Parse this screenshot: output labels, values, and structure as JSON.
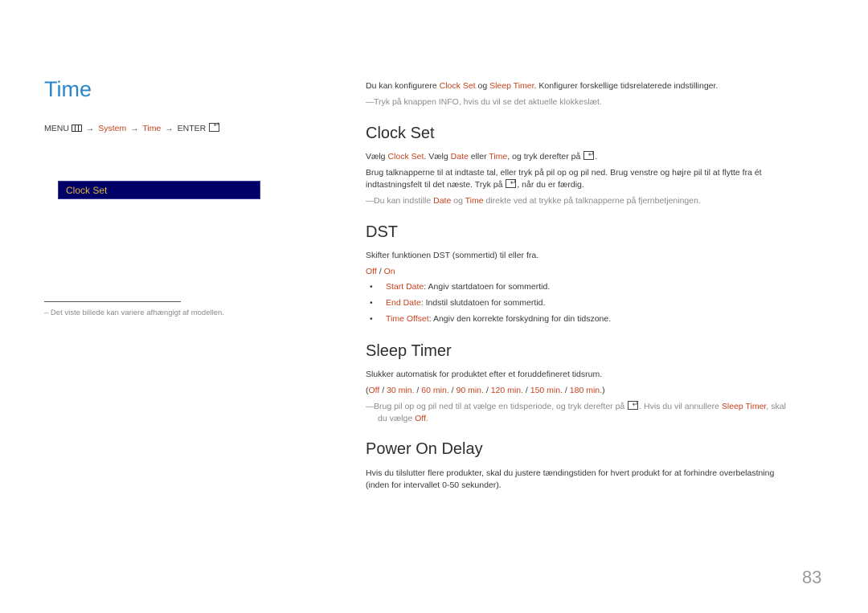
{
  "left": {
    "title": "Time",
    "menu_path": {
      "menu": "MENU",
      "menu_icon": "menu-grid-icon",
      "arrow": "→",
      "system": "System",
      "time": "Time",
      "enter": "ENTER",
      "enter_icon": "enter-icon"
    },
    "osd_item": "Clock Set",
    "footnote": "–  Det viste billede kan variere afhængigt af modellen."
  },
  "intro": {
    "t1": "Du kan konfigurere ",
    "h1": "Clock Set",
    "t2": " og ",
    "h2": "Sleep Timer",
    "t3": ". Konfigurer forskellige tidsrelaterede indstillinger.",
    "note_dash": "―",
    "note": "Tryk på knappen INFO, hvis du vil se det aktuelle klokkeslæt."
  },
  "clock_set": {
    "heading": "Clock Set",
    "l1_t1": "Vælg ",
    "l1_h1": "Clock Set",
    "l1_t2": ". Vælg ",
    "l1_h2": "Date",
    "l1_t3": " eller ",
    "l1_h3": "Time",
    "l1_t4": ", og tryk derefter på ",
    "l1_t5": ".",
    "l2": "Brug talknapperne til at indtaste tal, eller tryk på pil op og pil ned. Brug venstre og højre pil til at flytte fra ét",
    "l3_t1": "indtastningsfelt til det næste. Tryk på ",
    "l3_t2": ", når du er færdig.",
    "note_t1": "Du kan indstille ",
    "note_h1": "Date",
    "note_t2": " og ",
    "note_h2": "Time",
    "note_t3": " direkte ved at trykke på talknapperne på fjernbetjeningen."
  },
  "dst": {
    "heading": "DST",
    "desc": "Skifter funktionen DST (sommertid) til eller fra.",
    "opt_off": "Off",
    "opt_sep": " / ",
    "opt_on": "On",
    "bullets": [
      {
        "label": "Start Date",
        "text": ": Angiv startdatoen for sommertid."
      },
      {
        "label": "End Date",
        "text": ": Indstil slutdatoen for sommertid."
      },
      {
        "label": "Time Offset",
        "text": ": Angiv den korrekte forskydning for din tidszone."
      }
    ],
    "bullet_char": "•"
  },
  "sleep_timer": {
    "heading": "Sleep Timer",
    "desc": "Slukker automatisk for produktet efter et foruddefineret tidsrum.",
    "options": [
      "Off",
      "30 min.",
      "60 min.",
      "90 min.",
      "120 min.",
      "150 min.",
      "180 min."
    ],
    "open_paren": "(",
    "close_paren": ")",
    "sep": " / ",
    "note_t1": "Brug pil op og pil ned til at vælge en tidsperiode, og tryk derefter på ",
    "note_t2": ". Hvis du vil annullere ",
    "note_h1": "Sleep Timer",
    "note_t3": ", skal",
    "note_t4": "du vælge ",
    "note_h2": "Off",
    "note_t5": "."
  },
  "power_on_delay": {
    "heading": "Power On Delay",
    "l1": "Hvis du tilslutter flere produkter, skal du justere tændingstiden for hvert produkt for at forhindre overbelastning",
    "l2": "(inden for intervallet 0-50 sekunder)."
  },
  "page_number": "83"
}
